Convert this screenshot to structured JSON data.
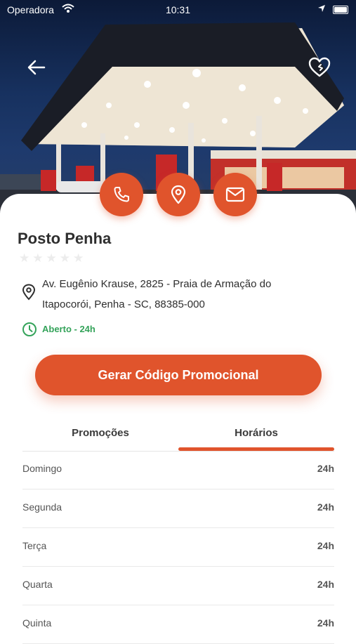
{
  "status_bar": {
    "carrier": "Operadora",
    "time": "10:31"
  },
  "station": {
    "name": "Posto Penha",
    "rating": 0,
    "address_line1": "Av. Eugênio Krause, 2825 - Praia de Armação do",
    "address_line2": "Itapocorói, Penha - SC, 88385-000",
    "open_status": "Aberto - 24h"
  },
  "actions": {
    "promo_button": "Gerar Código Promocional"
  },
  "tabs": [
    {
      "label": "Promoções",
      "active": false
    },
    {
      "label": "Horários",
      "active": true
    }
  ],
  "hours": [
    {
      "day": "Domingo",
      "value": "24h"
    },
    {
      "day": "Segunda",
      "value": "24h"
    },
    {
      "day": "Terça",
      "value": "24h"
    },
    {
      "day": "Quarta",
      "value": "24h"
    },
    {
      "day": "Quinta",
      "value": "24h"
    }
  ],
  "colors": {
    "accent": "#e0542c",
    "open": "#34a35a",
    "text": "#2e2e2e"
  },
  "icons": [
    "wifi-icon",
    "location-arrow-icon",
    "battery-icon",
    "back-arrow-icon",
    "heart-icon",
    "phone-icon",
    "map-pin-icon",
    "mail-icon",
    "star-icon",
    "location-pin-icon",
    "clock-icon"
  ]
}
